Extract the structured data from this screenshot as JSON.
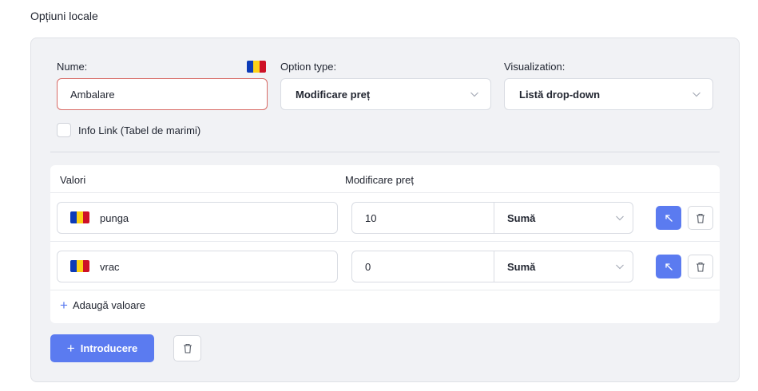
{
  "section": {
    "title": "Opțiuni locale"
  },
  "form": {
    "name_label": "Nume:",
    "name_value": "Ambalare",
    "option_type_label": "Option type:",
    "option_type_value": "Modificare preț",
    "visualization_label": "Visualization:",
    "visualization_value": "Listă drop-down",
    "info_link_label": "Info Link (Tabel de marimi)",
    "info_link_checked": false
  },
  "values_table": {
    "columns": [
      "Valori",
      "Modificare preț"
    ],
    "rows": [
      {
        "value": "punga",
        "price": "10",
        "price_type": "Sumă"
      },
      {
        "value": "vrac",
        "price": "0",
        "price_type": "Sumă"
      }
    ],
    "add_label": "Adaugă valoare"
  },
  "actions": {
    "submit_label": "Introducere"
  },
  "colors": {
    "accent": "#5b7bf0",
    "error_border": "#d86b66",
    "panel": "#f1f2f5"
  },
  "icons": {
    "flag": "romania-flag-icon",
    "up": "arrow-up-left-icon",
    "delete": "trash-icon",
    "dropdown": "chevron-down-icon"
  }
}
